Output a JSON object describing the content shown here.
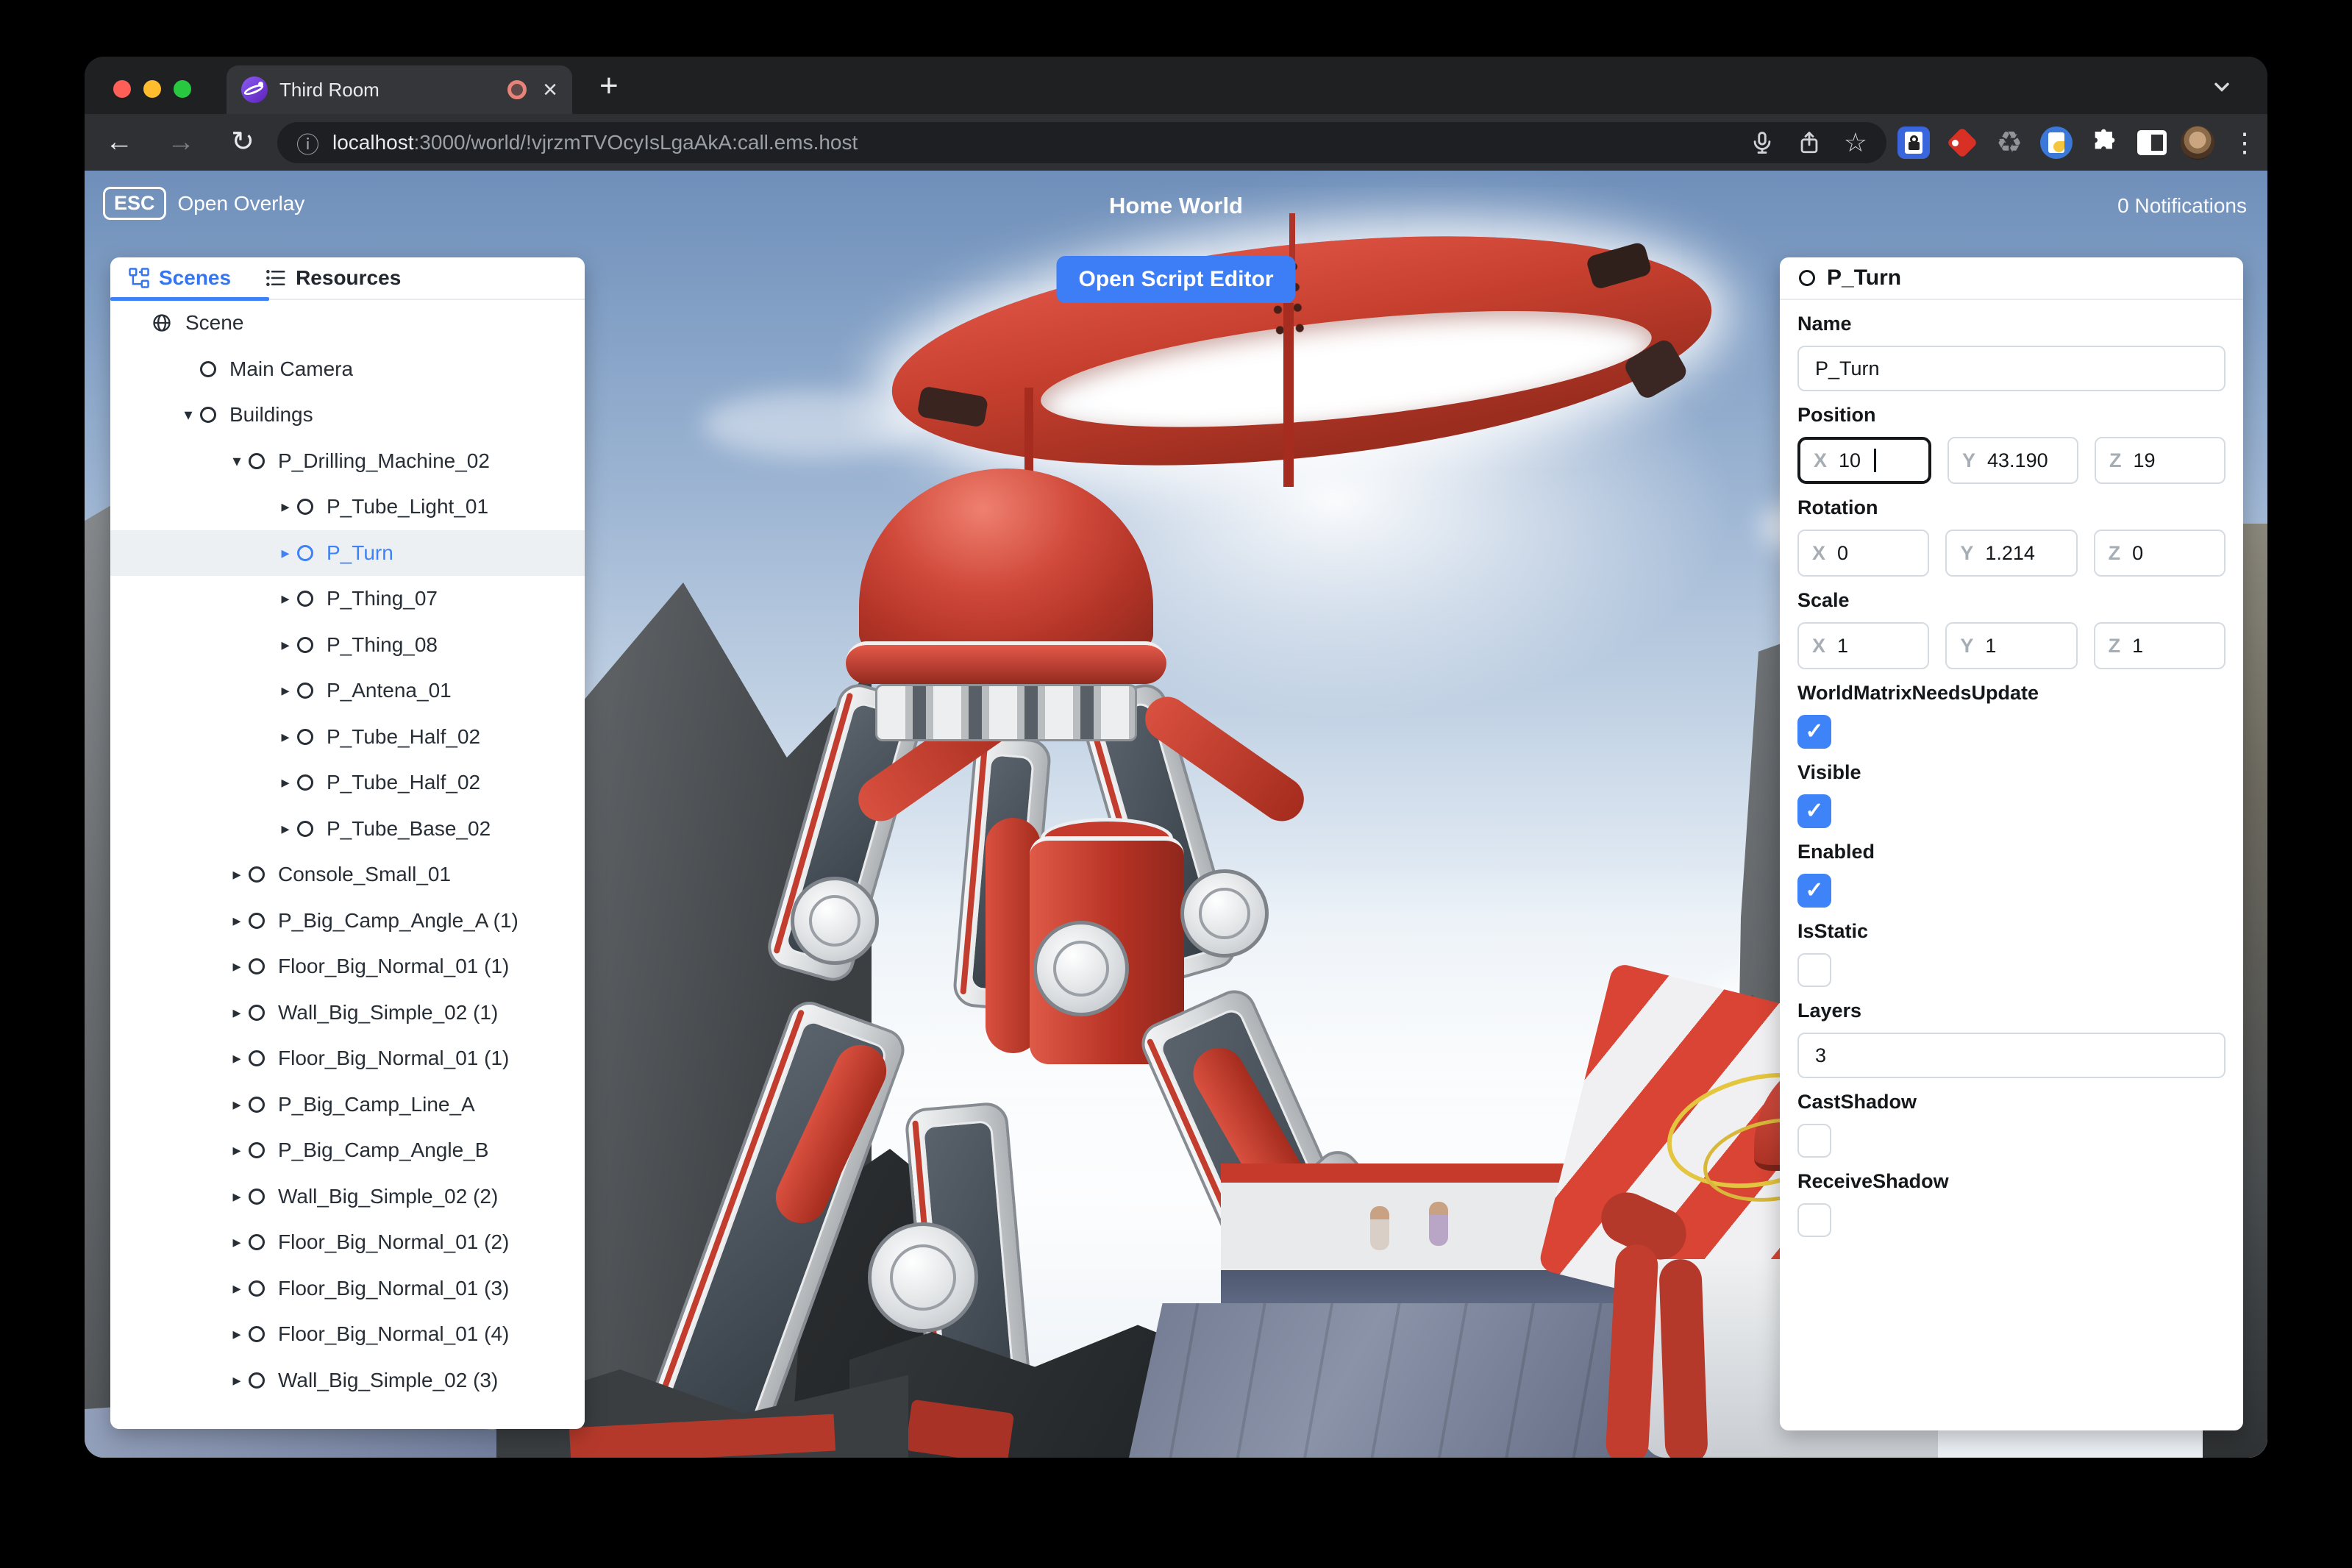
{
  "browser": {
    "tab_title": "Third Room",
    "url_host": "localhost",
    "url_rest": ":3000/world/!vjrzmTVOcyIsLgaAkA:call.ems.host",
    "icons": {
      "back": "←",
      "forward": "→",
      "reload": "↻",
      "info": "ⓘ",
      "star": "☆",
      "recycle": "♻",
      "menu": "⋮",
      "close": "×",
      "new_tab": "+"
    }
  },
  "hud": {
    "esc_key": "ESC",
    "open_overlay_label": "Open Overlay",
    "world_title": "Home World",
    "notifications_label": "0 Notifications",
    "open_script_editor_label": "Open Script Editor"
  },
  "left_panel": {
    "tabs": [
      {
        "label": "Scenes",
        "active": true
      },
      {
        "label": "Resources",
        "active": false
      }
    ],
    "tree_icons": {
      "caret_right": "▸",
      "caret_down": "▾"
    },
    "tree": [
      {
        "label": "Scene",
        "level": 0,
        "icon": "globe",
        "caret": "none",
        "selected": false
      },
      {
        "label": "Main Camera",
        "level": 1,
        "icon": "circle",
        "caret": "none",
        "selected": false
      },
      {
        "label": "Buildings",
        "level": 1,
        "icon": "circle",
        "caret": "down",
        "selected": false
      },
      {
        "label": "P_Drilling_Machine_02",
        "level": 2,
        "icon": "circle",
        "caret": "down",
        "selected": false
      },
      {
        "label": "P_Tube_Light_01",
        "level": 3,
        "icon": "circle",
        "caret": "right",
        "selected": false
      },
      {
        "label": "P_Turn",
        "level": 3,
        "icon": "circle",
        "caret": "right",
        "selected": true
      },
      {
        "label": "P_Thing_07",
        "level": 3,
        "icon": "circle",
        "caret": "right",
        "selected": false
      },
      {
        "label": "P_Thing_08",
        "level": 3,
        "icon": "circle",
        "caret": "right",
        "selected": false
      },
      {
        "label": "P_Antena_01",
        "level": 3,
        "icon": "circle",
        "caret": "right",
        "selected": false
      },
      {
        "label": "P_Tube_Half_02",
        "level": 3,
        "icon": "circle",
        "caret": "right",
        "selected": false
      },
      {
        "label": "P_Tube_Half_02",
        "level": 3,
        "icon": "circle",
        "caret": "right",
        "selected": false
      },
      {
        "label": "P_Tube_Base_02",
        "level": 3,
        "icon": "circle",
        "caret": "right",
        "selected": false
      },
      {
        "label": "Console_Small_01",
        "level": 2,
        "icon": "circle",
        "caret": "right",
        "selected": false
      },
      {
        "label": "P_Big_Camp_Angle_A (1)",
        "level": 2,
        "icon": "circle",
        "caret": "right",
        "selected": false
      },
      {
        "label": "Floor_Big_Normal_01 (1)",
        "level": 2,
        "icon": "circle",
        "caret": "right",
        "selected": false
      },
      {
        "label": "Wall_Big_Simple_02 (1)",
        "level": 2,
        "icon": "circle",
        "caret": "right",
        "selected": false
      },
      {
        "label": "Floor_Big_Normal_01 (1)",
        "level": 2,
        "icon": "circle",
        "caret": "right",
        "selected": false
      },
      {
        "label": "P_Big_Camp_Line_A",
        "level": 2,
        "icon": "circle",
        "caret": "right",
        "selected": false
      },
      {
        "label": "P_Big_Camp_Angle_B",
        "level": 2,
        "icon": "circle",
        "caret": "right",
        "selected": false
      },
      {
        "label": "Wall_Big_Simple_02 (2)",
        "level": 2,
        "icon": "circle",
        "caret": "right",
        "selected": false
      },
      {
        "label": "Floor_Big_Normal_01 (2)",
        "level": 2,
        "icon": "circle",
        "caret": "right",
        "selected": false
      },
      {
        "label": "Floor_Big_Normal_01 (3)",
        "level": 2,
        "icon": "circle",
        "caret": "right",
        "selected": false
      },
      {
        "label": "Floor_Big_Normal_01 (4)",
        "level": 2,
        "icon": "circle",
        "caret": "right",
        "selected": false
      },
      {
        "label": "Wall_Big_Simple_02 (3)",
        "level": 2,
        "icon": "circle",
        "caret": "right",
        "selected": false
      }
    ]
  },
  "inspector": {
    "title": "P_Turn",
    "check_glyph": "✓",
    "sections": [
      {
        "type": "text",
        "name": "name",
        "label": "Name",
        "value": "P_Turn"
      },
      {
        "type": "vector",
        "name": "position",
        "label": "Position",
        "x": "10",
        "y": "43.190",
        "z": "19",
        "focused": "x"
      },
      {
        "type": "vector",
        "name": "rotation",
        "label": "Rotation",
        "x": "0",
        "y": "1.214",
        "z": "0",
        "focused": ""
      },
      {
        "type": "vector",
        "name": "scale",
        "label": "Scale",
        "x": "1",
        "y": "1",
        "z": "1",
        "focused": ""
      },
      {
        "type": "checkbox",
        "name": "worldmatrixneedsupdate",
        "label": "WorldMatrixNeedsUpdate",
        "checked": true
      },
      {
        "type": "checkbox",
        "name": "visible",
        "label": "Visible",
        "checked": true
      },
      {
        "type": "checkbox",
        "name": "enabled",
        "label": "Enabled",
        "checked": true
      },
      {
        "type": "checkbox",
        "name": "isstatic",
        "label": "IsStatic",
        "checked": false
      },
      {
        "type": "text",
        "name": "layers",
        "label": "Layers",
        "value": "3"
      },
      {
        "type": "checkbox",
        "name": "castshadow",
        "label": "CastShadow",
        "checked": false
      },
      {
        "type": "checkbox",
        "name": "receiveshadow",
        "label": "ReceiveShadow",
        "checked": false
      }
    ]
  },
  "colors": {
    "accent_blue": "#3b82f6",
    "button_blue": "#3d7ef7",
    "selected_row_bg": "#edf0f3",
    "checkbox_checked": "#3f83f8",
    "machine_red": "#c8402f"
  }
}
